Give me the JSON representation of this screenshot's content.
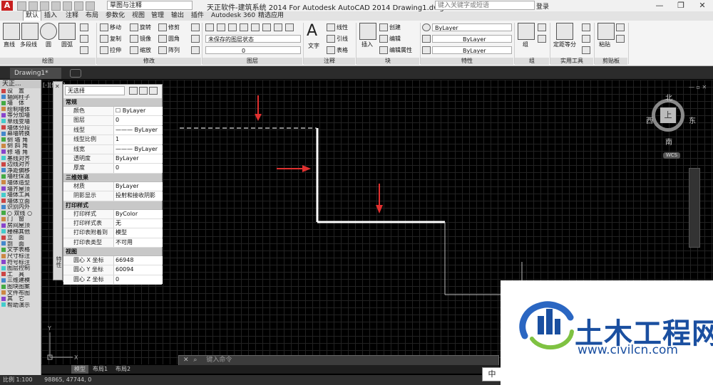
{
  "titlebar": {
    "title": "天正软件-建筑系统 2014  For Autodesk AutoCAD 2014    Drawing1.dwg",
    "workspace": "草图与注释",
    "search_placeholder": "键入关键字或短语",
    "login": "登录",
    "logo": "A",
    "minimize": "—",
    "restore": "❐",
    "close": "✕"
  },
  "ribbon_tabs": [
    "默认",
    "插入",
    "注释",
    "布局",
    "参数化",
    "视图",
    "管理",
    "输出",
    "插件",
    "Autodesk 360",
    "精选应用"
  ],
  "ribbon": {
    "draw": {
      "label": "绘图",
      "line": "直线",
      "polyline": "多段线",
      "circle": "圆",
      "arc": "圆弧"
    },
    "modify": {
      "label": "修改",
      "move": "移动",
      "rotate": "旋转",
      "trim": "修剪",
      "copy": "复制",
      "mirror": "镜像",
      "fillet": "圆角",
      "stretch": "拉伸",
      "scale": "缩放",
      "array": "阵列"
    },
    "layers": {
      "label": "图层",
      "state": "未保存的图层状态",
      "current": "0"
    },
    "annotation": {
      "label": "注释",
      "text": "文字",
      "linear": "线性",
      "leader": "引线",
      "table": "表格"
    },
    "block": {
      "label": "块",
      "insert": "插入",
      "create": "创建",
      "edit": "编辑",
      "edit_attr": "编辑属性"
    },
    "properties": {
      "label": "特性",
      "color": "ByLayer",
      "linetype": "ByLayer",
      "lineweight": "ByLayer"
    },
    "groups": {
      "label": "组",
      "group": "组"
    },
    "utilities": {
      "label": "实用工具",
      "measure": "定距等分"
    },
    "clipboard": {
      "label": "剪贴板",
      "paste": "粘贴"
    }
  },
  "doc_tab": "Drawing1*",
  "left_panel": {
    "title": "天正...",
    "items": [
      "设　置",
      "轴网柱子",
      "墙　体",
      "绘制墙体",
      "等分加墙",
      "单线变墙",
      "墙体分段",
      "幕墙转换",
      "倒 墙 角",
      "倒 斜 角",
      "修 墙 角",
      "基线对齐",
      "边线对齐",
      "净距偏移",
      "墙柱保温",
      "墙体造型",
      "墙齐屋顶",
      "墙体工具",
      "墙体立面",
      "识别内外",
      "○ 双线 ○",
      "门　窗",
      "房间屋顶",
      "楼梯其他",
      "立　面",
      "剖　面",
      "文字表格",
      "尺寸标注",
      "符号标注",
      "图层控制",
      "工　具",
      "三维建模",
      "图块图案",
      "文件布图",
      "其　它",
      "帮助演示"
    ]
  },
  "properties_palette": {
    "selection": "无选择",
    "side_label": "特性",
    "sections": [
      {
        "title": "常规",
        "rows": [
          [
            "颜色",
            "☐ ByLayer"
          ],
          [
            "图层",
            "0"
          ],
          [
            "线型",
            "——— ByLayer"
          ],
          [
            "线型比例",
            "1"
          ],
          [
            "线宽",
            "——— ByLayer"
          ],
          [
            "透明度",
            "ByLayer"
          ],
          [
            "厚度",
            "0"
          ]
        ]
      },
      {
        "title": "三维效果",
        "rows": [
          [
            "材质",
            "ByLayer"
          ],
          [
            "阴影显示",
            "投射和接收阴影"
          ]
        ]
      },
      {
        "title": "打印样式",
        "rows": [
          [
            "打印样式",
            "ByColor"
          ],
          [
            "打印样式表",
            "无"
          ],
          [
            "打印表附着到",
            "模型"
          ],
          [
            "打印表类型",
            "不可用"
          ]
        ]
      },
      {
        "title": "视图",
        "rows": [
          [
            "圆心 X 坐标",
            "66948"
          ],
          [
            "圆心 Y 坐标",
            "60094"
          ],
          [
            "圆心 Z 坐标",
            "0"
          ]
        ]
      }
    ]
  },
  "viewcube": {
    "north": "北",
    "south": "南",
    "east": "东",
    "west": "西",
    "face": "上",
    "wcs": "WCS"
  },
  "viewport_label": "[-][俯视]",
  "command_placeholder": "键入命令",
  "layout_tabs": [
    "模型",
    "布局1",
    "布局2"
  ],
  "status": {
    "scale": "比例 1:100",
    "coords": "98865,  47744, 0"
  },
  "ime": "中",
  "watermark": {
    "title": "土木工程网",
    "url": "www.civilcn.com"
  },
  "colors": {
    "accent": "#c81f1f",
    "arrow": "#e0302f",
    "watermark": "#1a4fa0",
    "line": "#ffffff"
  }
}
